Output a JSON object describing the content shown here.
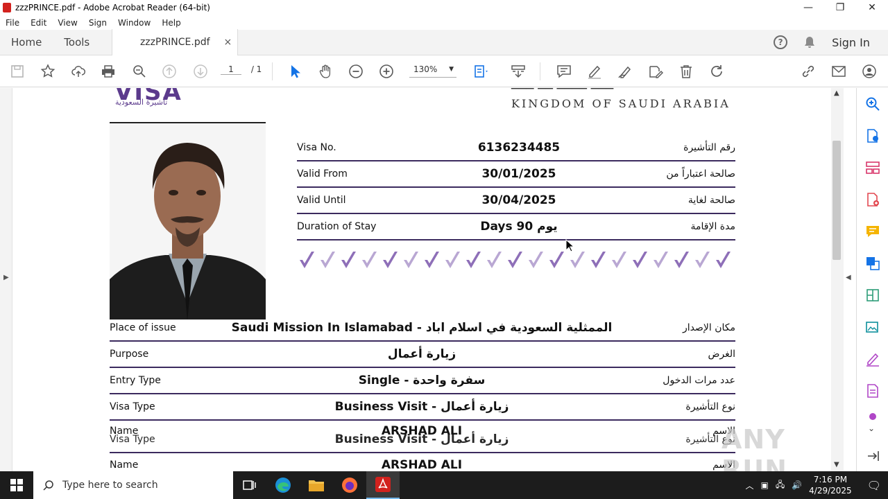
{
  "window": {
    "title": "zzzPRINCE.pdf - Adobe Acrobat Reader (64-bit)",
    "minimize": "—",
    "maximize": "❐",
    "close": "✕"
  },
  "menu": [
    "File",
    "Edit",
    "View",
    "Sign",
    "Window",
    "Help"
  ],
  "tabs": {
    "home": "Home",
    "tools": "Tools",
    "document": "zzzPRINCE.pdf",
    "close": "×",
    "help": "?",
    "sign_in": "Sign In"
  },
  "toolbar": {
    "page_current": "1",
    "page_total": "/ 1",
    "zoom": "130%"
  },
  "document": {
    "visa_logo": "VISA",
    "visa_logo_ar": "تأشيرة السعودية",
    "kingdom": "KINGDOM OF SAUDI ARABIA",
    "fields": [
      {
        "label": "Visa No.",
        "value": "6136234485",
        "ar": "رقم التأشيرة"
      },
      {
        "label": "Valid From",
        "value": "30/01/2025",
        "ar": "صالحة اعتباراً من"
      },
      {
        "label": "Valid Until",
        "value": "30/04/2025",
        "ar": "صالحة لغاية"
      },
      {
        "label": "Duration of Stay",
        "value": "Days 90 يوم",
        "ar": "مدة الإقامة"
      }
    ],
    "details": [
      {
        "label": "Place of issue",
        "value": "Saudi Mission In Islamabad - الممثلية السعودية في اسلام اباد",
        "ar": "مكان الإصدار"
      },
      {
        "label": "Purpose",
        "value": "زيارة أعمال",
        "ar": "الغرض"
      },
      {
        "label": "Entry Type",
        "value": "Single - سفرة واحدة",
        "ar": "عدد مرات الدخول"
      },
      {
        "label": "Visa Type",
        "value": "Business Visit - زيارة أعمال",
        "ar": "نوع التأشيرة"
      },
      {
        "label": "Name",
        "value": "ARSHAD ALI",
        "ar": "الاسم"
      }
    ],
    "repeat": [
      {
        "label": "Visa Type",
        "value": "Business Visit - زيارة أعمال",
        "ar": "نوع التأشيرة"
      },
      {
        "label": "Name",
        "value": "ARSHAD ALI",
        "ar": "الاسم"
      }
    ]
  },
  "watermark": "ANY RUN",
  "taskbar": {
    "search_placeholder": "Type here to search",
    "time": "7:16 PM",
    "date": "4/29/2025"
  },
  "colors": {
    "accent_purple": "#5b3a8c",
    "rule": "#3b2a5e",
    "check": "#8e6fb8",
    "acrobat_red": "#d2221e",
    "toolbar_blue": "#1473e6"
  }
}
